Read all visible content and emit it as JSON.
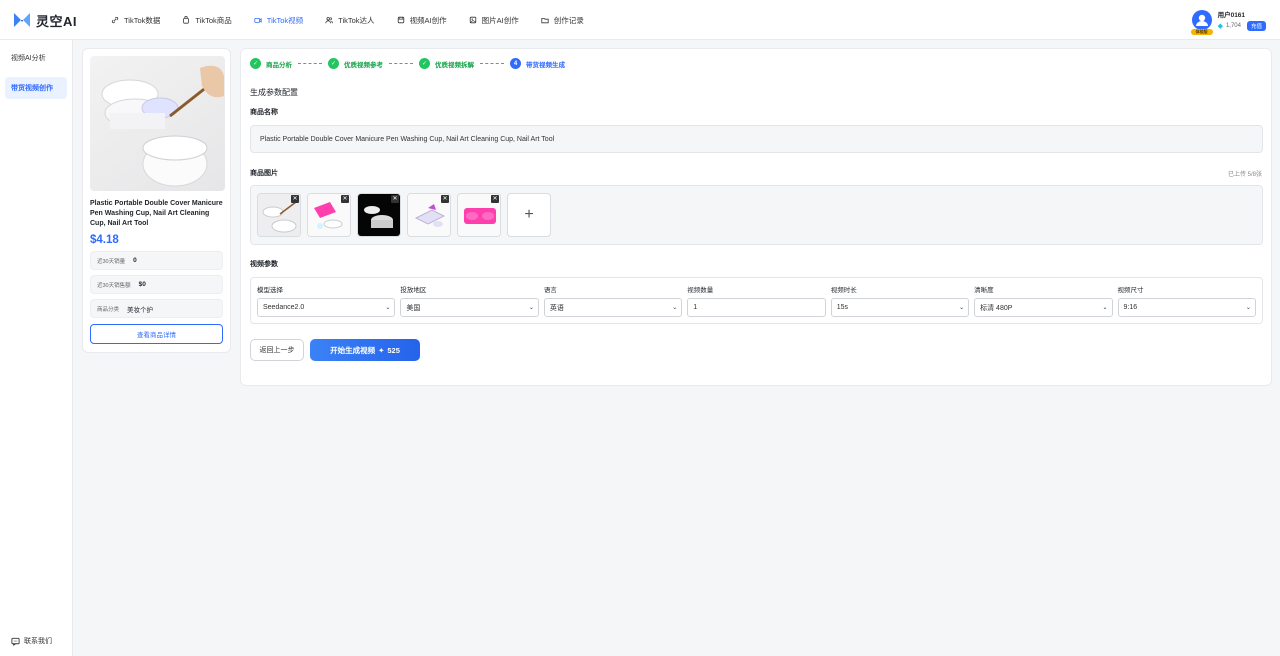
{
  "app": {
    "name": "灵空AI"
  },
  "nav": [
    {
      "label": "TikTok数据",
      "icon": "link-icon"
    },
    {
      "label": "TikTok商品",
      "icon": "bag-icon"
    },
    {
      "label": "TikTok视频",
      "icon": "video-icon"
    },
    {
      "label": "TikTok达人",
      "icon": "users-icon"
    },
    {
      "label": "视频AI创作",
      "icon": "film-icon"
    },
    {
      "label": "图片AI创作",
      "icon": "image-icon"
    },
    {
      "label": "创作记录",
      "icon": "folder-icon"
    }
  ],
  "active_nav": "TikTok视频",
  "user": {
    "name": "用户0161",
    "credits": "1,704",
    "recharge": "充值",
    "badge": "体验版"
  },
  "sidebar": {
    "items": [
      {
        "label": "视频AI分析"
      },
      {
        "label": "带货视频创作"
      }
    ],
    "contact": "联系我们"
  },
  "product": {
    "title": "Plastic Portable Double Cover Manicure Pen Washing Cup, Nail Art Cleaning Cup, Nail Art Tool",
    "price": "$4.18",
    "stats": [
      {
        "label": "近30天销量",
        "value": "0"
      },
      {
        "label": "近30天销售额",
        "value": "$0"
      },
      {
        "label": "商品分类",
        "value": "美妆个护"
      }
    ],
    "detail_button": "查看商品详情"
  },
  "steps": [
    {
      "label": "商品分析",
      "state": "done"
    },
    {
      "label": "优质视频参考",
      "state": "done"
    },
    {
      "label": "优质视频拆解",
      "state": "done"
    },
    {
      "label": "带货视频生成",
      "state": "current",
      "number": "4"
    }
  ],
  "config": {
    "title": "生成参数配置",
    "name_label": "商品名称",
    "name_value": "Plastic Portable Double Cover Manicure Pen Washing Cup, Nail Art Cleaning Cup, Nail Art Tool",
    "images_label": "商品图片",
    "upload_count": "已上传 5/8张",
    "params_label": "视频参数",
    "params": [
      {
        "label": "模型选择",
        "value": "Seedance2.0"
      },
      {
        "label": "投放地区",
        "value": "美国"
      },
      {
        "label": "语言",
        "value": "英语"
      },
      {
        "label": "视频数量",
        "value": "1"
      },
      {
        "label": "视频时长",
        "value": "15s"
      },
      {
        "label": "清晰度",
        "value": "标清 480P"
      },
      {
        "label": "视频尺寸",
        "value": "9:16"
      }
    ],
    "back_button": "返回上一步",
    "generate_button": "开始生成视频",
    "generate_cost": "525"
  }
}
